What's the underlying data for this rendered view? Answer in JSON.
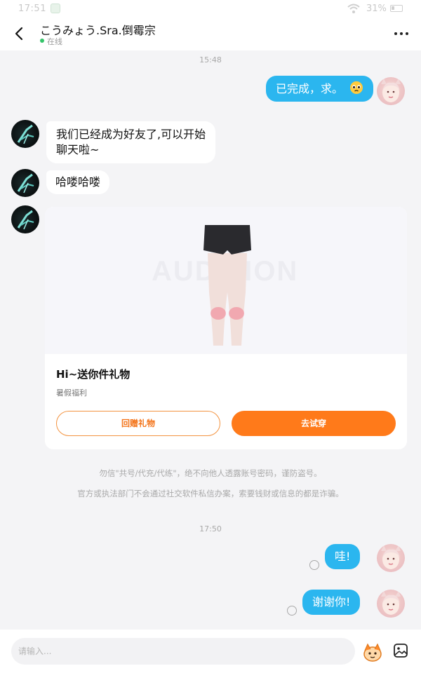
{
  "status_bar": {
    "time": "17:51",
    "battery": "31%"
  },
  "header": {
    "contact_name": "こうみょう.Sra.倒霉宗",
    "status": "在线"
  },
  "messages": [
    {
      "from": "timestamp",
      "text": "15:48"
    },
    {
      "from": "self",
      "text": "已完成，求。",
      "emoji": "pleading-face-icon"
    },
    {
      "from": "other",
      "lines": [
        "我们已经成为好友了,可以开始",
        "聊天啦~"
      ]
    },
    {
      "from": "other",
      "text": "哈喽哈喽"
    },
    {
      "from": "timestamp",
      "text": "17:50"
    },
    {
      "from": "self",
      "text": "哇!"
    },
    {
      "from": "self",
      "text": "谢谢你!"
    }
  ],
  "gift_card": {
    "watermark": "AUDITION",
    "title": "Hi~送你件礼物",
    "subtitle": "暑假福利",
    "return_gift_label": "回赠礼物",
    "try_on_label": "去试穿"
  },
  "notices": [
    "勿信\"共号/代充/代练\"，绝不向他人透露账号密码，谨防盗号。",
    "官方或执法部门不会通过社交软件私信办案，索要钱财或信息的都是诈骗。"
  ],
  "input": {
    "placeholder": "请输入..."
  },
  "colors": {
    "bubble_out": "#2bb6ef",
    "bubble_in": "#ffffff",
    "accent_orange": "#ff7a1a",
    "online_green": "#35c56a",
    "background": "#f4f4f6"
  }
}
